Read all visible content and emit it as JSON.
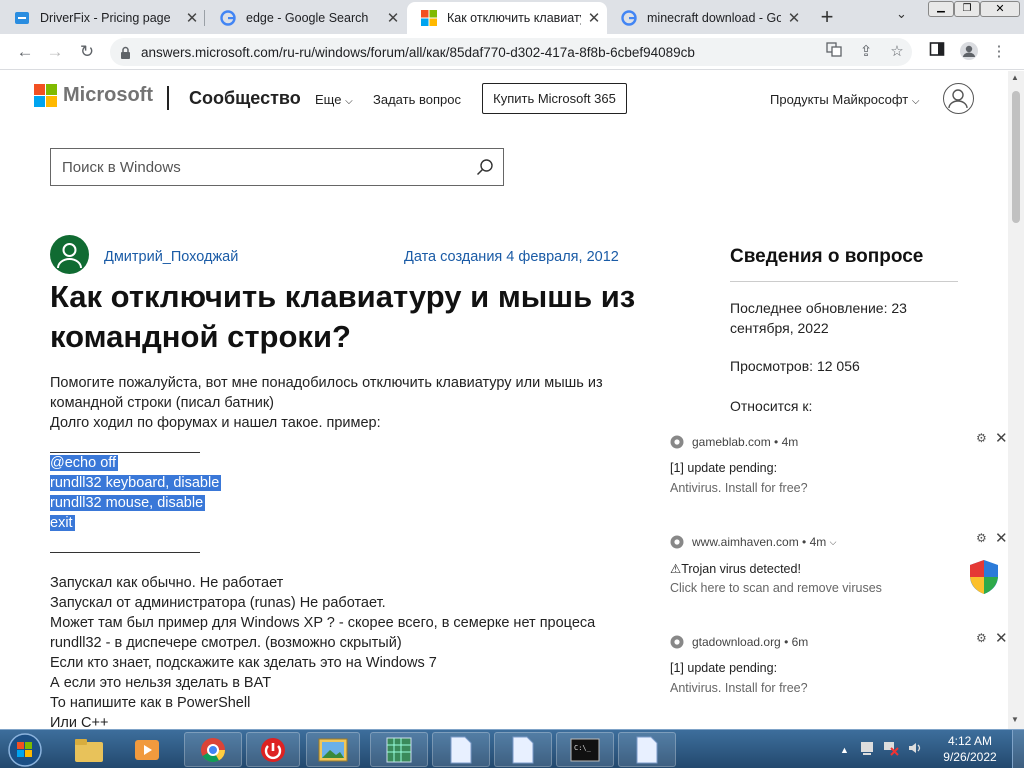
{
  "browser": {
    "tabs": [
      {
        "title": "DriverFix - Pricing page",
        "icon": "driverfix-favicon-icon"
      },
      {
        "title": "edge - Google Search",
        "icon": "google-favicon-icon"
      },
      {
        "title": "Как отключить клавиату",
        "icon": "microsoft-favicon-icon",
        "active": true
      },
      {
        "title": "minecraft download - Go",
        "icon": "google-favicon-icon"
      }
    ],
    "new_tab": "+",
    "url": "answers.microsoft.com/ru-ru/windows/forum/all/как/85daf770-d302-417a-8f8b-6cbef94089cb"
  },
  "header": {
    "brand": "Microsoft",
    "community": "Сообщество",
    "more": "Еще",
    "ask": "Задать вопрос",
    "buy": "Купить Microsoft 365",
    "products": "Продукты Майкрософт"
  },
  "search": {
    "placeholder": "Поиск в Windows"
  },
  "question": {
    "author": "Дмитрий_Походжай",
    "created": "Дата создания 4 февраля, 2012",
    "title": "Как отключить клавиатуру и мышь из командной строки?",
    "intro": [
      "Помогите пожалуйста, вот мне понадобилось отключить клавиатуру или мышь из",
      "командной строки (писал батник)",
      "Долго ходил по форумах и нашел такое. пример:"
    ],
    "code": [
      "@echo off",
      "rundll32 keyboard, disable",
      "rundll32 mouse, disable",
      "exit"
    ],
    "outro": [
      "Запускал как обычно. Не работает",
      "Запускал от администратора (runas) Не работает.",
      "Может там был пример для Windows XP ? - скорее всего, в семерке нет процеса",
      "rundll32 - в диспечере смотрел. (возможно скрытый)",
      "Если кто знает, подскажите как зделать это на Windows 7",
      "А если это нельзя зделать в BAT",
      "То напишите как в PowerShell",
      "Или C++"
    ]
  },
  "sidebar": {
    "heading": "Сведения о вопросе",
    "updated": "Последнее обновление: 23 сентября, 2022",
    "views": "Просмотров: 12 056",
    "applies": "Относится к:"
  },
  "notifications": [
    {
      "source": "gameblab.com",
      "time": "4m",
      "line1": "[1] update pending:",
      "line2": "Antivirus. Install for free?"
    },
    {
      "source": "www.aimhaven.com",
      "time": "4m",
      "line1": "⚠Trojan virus detected!",
      "line2": "Click here to scan and remove viruses"
    },
    {
      "source": "gtadownload.org",
      "time": "6m",
      "line1": "[1] update pending:",
      "line2": "Antivirus. Install for free?"
    }
  ],
  "taskbar": {
    "time": "4:12 AM",
    "date": "9/26/2022"
  }
}
